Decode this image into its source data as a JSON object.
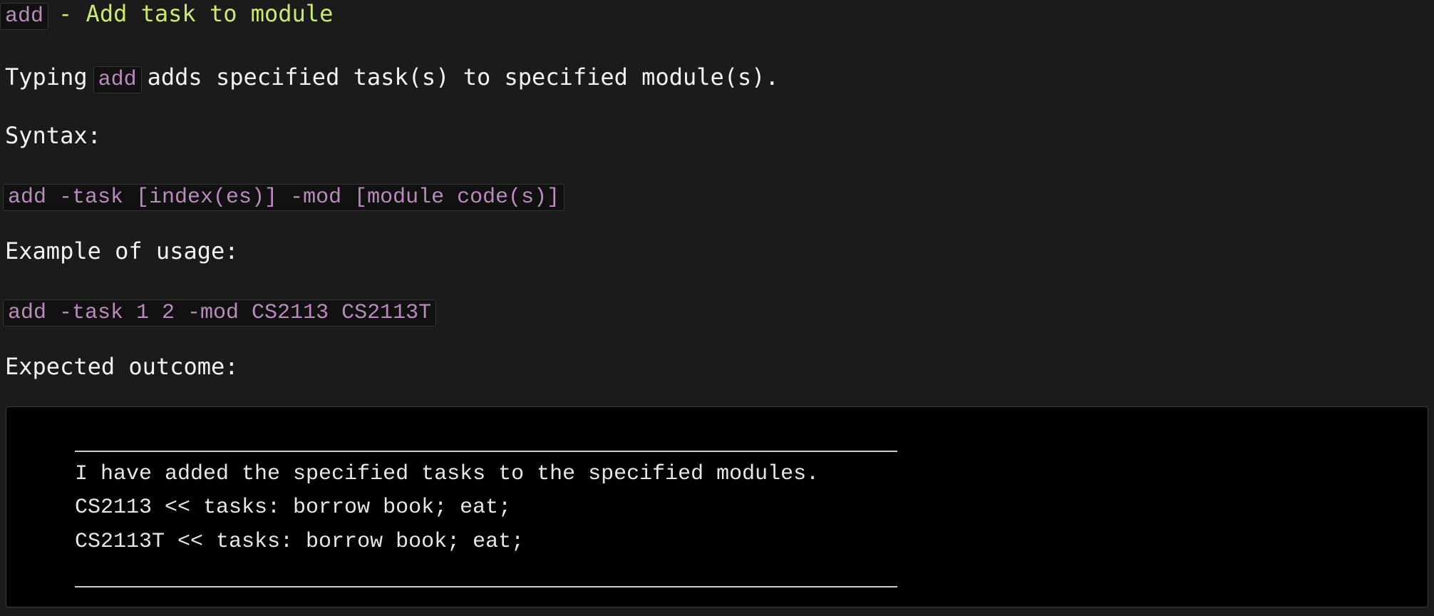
{
  "heading": {
    "code": "add",
    "text": "- Add task to module"
  },
  "intro": {
    "before": "Typing",
    "code": "add",
    "after": "adds specified task(s) to specified module(s)."
  },
  "syntax": {
    "label": "Syntax:",
    "code": "add -task [index(es)] -mod [module code(s)]"
  },
  "example": {
    "label": "Example of usage:",
    "code": "add -task 1 2 -mod CS2113 CS2113T"
  },
  "outcome": {
    "label": "Expected outcome:",
    "lines": [
      "I have added the specified tasks to the specified modules.",
      "CS2113 << tasks: borrow book; eat;",
      "CS2113T << tasks: borrow book; eat;"
    ]
  }
}
